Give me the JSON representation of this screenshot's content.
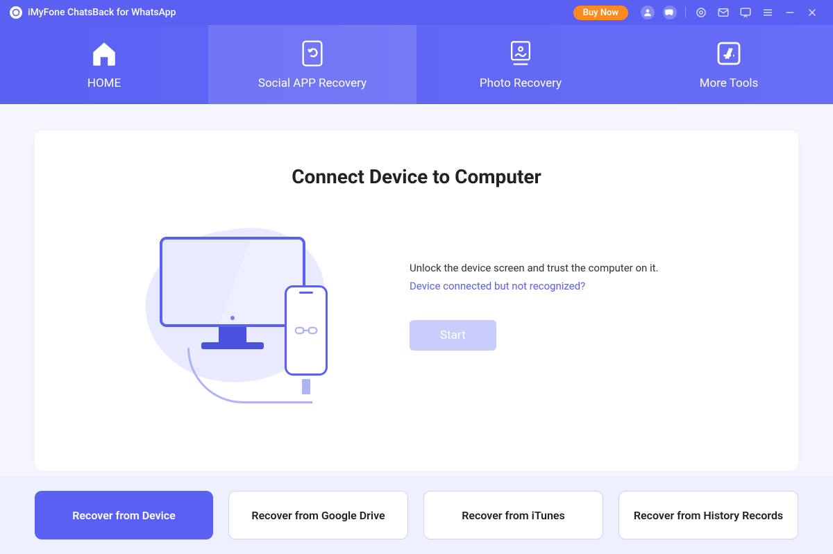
{
  "app": {
    "title": "iMyFone ChatsBack for WhatsApp"
  },
  "titlebar": {
    "buy_label": "Buy Now"
  },
  "tabs": [
    {
      "label": "HOME"
    },
    {
      "label": "Social APP Recovery"
    },
    {
      "label": "Photo Recovery"
    },
    {
      "label": "More Tools"
    }
  ],
  "main": {
    "heading": "Connect Device to Computer",
    "instruction": "Unlock the device screen and trust the computer on it.",
    "help_link": "Device connected but not recognized?",
    "start_label": "Start"
  },
  "options": [
    {
      "label": "Recover from Device",
      "active": true
    },
    {
      "label": "Recover from Google Drive",
      "active": false
    },
    {
      "label": "Recover from iTunes",
      "active": false
    },
    {
      "label": "Recover from History Records",
      "active": false
    }
  ]
}
